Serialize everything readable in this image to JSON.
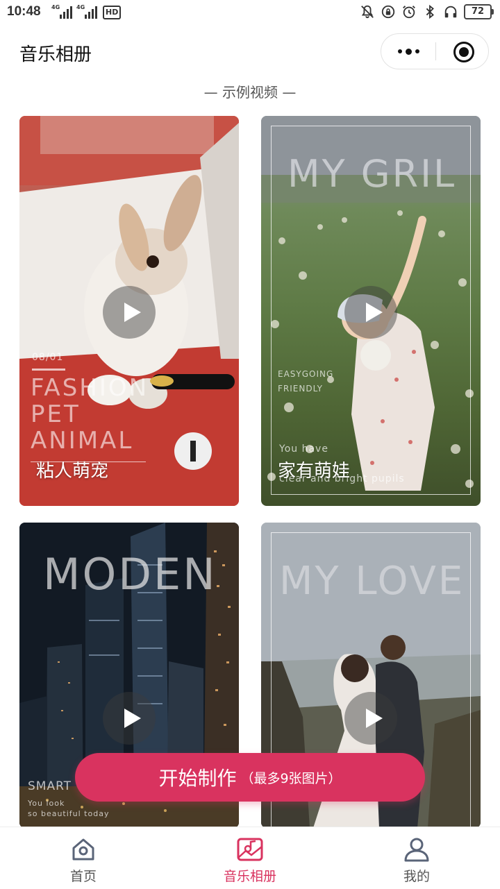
{
  "status_bar": {
    "time": "10:48",
    "network_1": "4G",
    "network_2": "4G",
    "hd_badge": "HD",
    "battery": "72",
    "icons": [
      "notification-off-icon",
      "lock-rotation-icon",
      "alarm-icon",
      "bluetooth-icon",
      "headphones-icon",
      "battery-icon"
    ]
  },
  "header": {
    "title": "音乐相册",
    "capsule_icons": [
      "more-icon",
      "close-miniprogram-icon"
    ]
  },
  "section_label": "— 示例视频 —",
  "cards": [
    {
      "title": "粘人萌宠",
      "overlay": {
        "date": "08/01",
        "line1": "FASHION",
        "line2": "PET",
        "line3": "ANIMAL"
      }
    },
    {
      "title": "家有萌娃",
      "overlay": {
        "headline": "MY GRIL",
        "sub1": "EASYGOING",
        "sub2": "FRIENDLY",
        "caption1": "You have",
        "caption2": "clear and bright pupils"
      }
    },
    {
      "title": "",
      "overlay": {
        "headline": "MODEN",
        "sub1": "SMART",
        "caption1": "You look",
        "caption2": "so beautiful today"
      }
    },
    {
      "title": "",
      "overlay": {
        "headline": "MY LOVE"
      }
    }
  ],
  "start_button": {
    "label": "开始制作",
    "note": "（最多9张图片）"
  },
  "tabbar": {
    "tabs": [
      {
        "label": "首页",
        "icon": "home-icon",
        "active": false
      },
      {
        "label": "音乐相册",
        "icon": "music-album-icon",
        "active": true
      },
      {
        "label": "我的",
        "icon": "profile-icon",
        "active": false
      }
    ]
  },
  "colors": {
    "accent": "#d9335f",
    "inactive_icon": "#5a6478"
  }
}
